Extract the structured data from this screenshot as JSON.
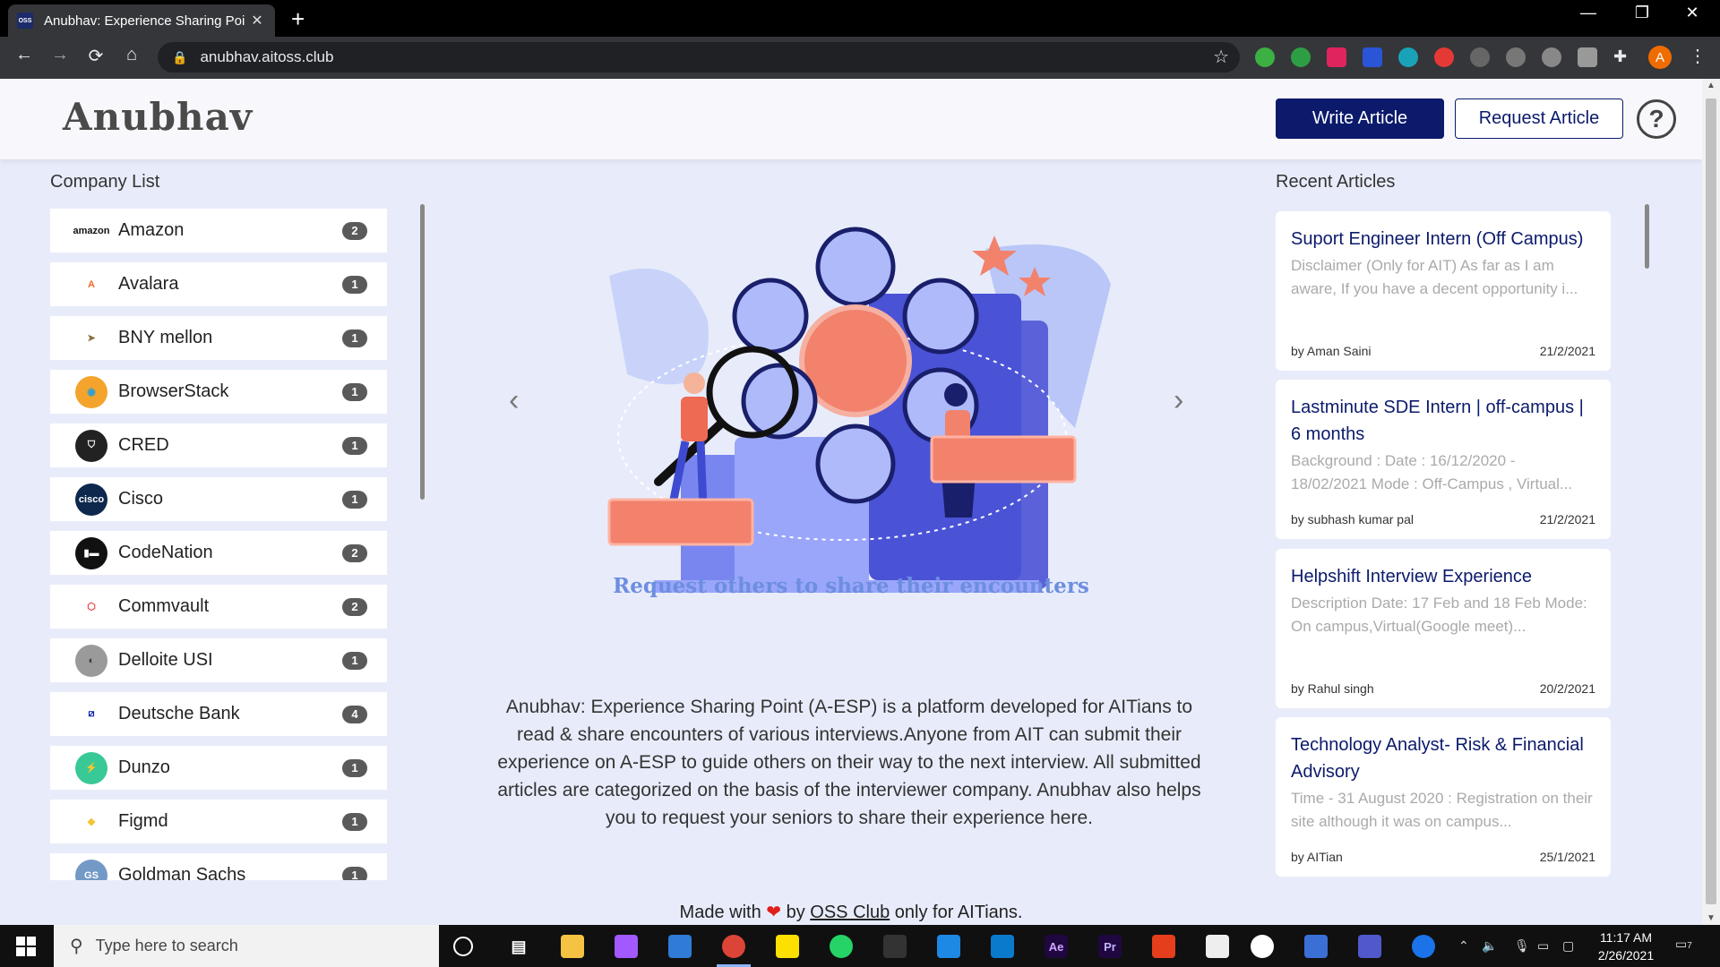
{
  "browser": {
    "tab_title": "Anubhav: Experience Sharing Poi",
    "tab_favicon_text": "OSS",
    "url": "anubhav.aitoss.club",
    "profile_initial": "A"
  },
  "header": {
    "logo": "Anubhav",
    "write_label": "Write Article",
    "request_label": "Request Article",
    "help_symbol": "?"
  },
  "company_section": {
    "title": "Company List",
    "items": [
      {
        "name": "Amazon",
        "count": "2",
        "logo_text": "amazon",
        "logo_color": "#111111",
        "logo_bg": "#ffffff"
      },
      {
        "name": "Avalara",
        "count": "1",
        "logo_text": "A",
        "logo_color": "#f2672a",
        "logo_bg": "#ffffff"
      },
      {
        "name": "BNY mellon",
        "count": "1",
        "logo_text": "➤",
        "logo_color": "#8a6d3b",
        "logo_bg": "#ffffff"
      },
      {
        "name": "BrowserStack",
        "count": "1",
        "logo_text": "◉",
        "logo_color": "#2a9fd6",
        "logo_bg": "#f4a42c"
      },
      {
        "name": "CRED",
        "count": "1",
        "logo_text": "⛉",
        "logo_color": "#ffffff",
        "logo_bg": "#222222"
      },
      {
        "name": "Cisco",
        "count": "1",
        "logo_text": "cisco",
        "logo_color": "#ffffff",
        "logo_bg": "#0d274d"
      },
      {
        "name": "CodeNation",
        "count": "2",
        "logo_text": "▮▬",
        "logo_color": "#ffffff",
        "logo_bg": "#111111"
      },
      {
        "name": "Commvault",
        "count": "2",
        "logo_text": "⬡",
        "logo_color": "#e0413d",
        "logo_bg": "#ffffff"
      },
      {
        "name": "Delloite USI",
        "count": "1",
        "logo_text": "◐",
        "logo_color": "#333333",
        "logo_bg": "#9a9a9a"
      },
      {
        "name": "Deutsche Bank",
        "count": "4",
        "logo_text": "⧄",
        "logo_color": "#0018a8",
        "logo_bg": "#ffffff"
      },
      {
        "name": "Dunzo",
        "count": "1",
        "logo_text": "⚡",
        "logo_color": "#111111",
        "logo_bg": "#38c996"
      },
      {
        "name": "Figmd",
        "count": "1",
        "logo_text": "◆",
        "logo_color": "#f4c430",
        "logo_bg": "#ffffff"
      },
      {
        "name": "Goldman Sachs",
        "count": "1",
        "logo_text": "GS",
        "logo_color": "#ffffff",
        "logo_bg": "#7399c6"
      }
    ]
  },
  "carousel": {
    "prev_symbol": "‹",
    "next_symbol": "›",
    "caption": "Request others to share their encounters"
  },
  "description": "Anubhav: Experience Sharing Point (A-ESP) is a platform developed for AITians to read & share encounters of various interviews.Anyone from AIT can submit their experience on A-ESP to guide others on their way to the next interview. All submitted articles are categorized on the basis of the interviewer company. Anubhav also helps you to request your seniors to share their experience here.",
  "footer": {
    "prefix": "Made with",
    "heart": "❤",
    "by": "by",
    "link": "OSS Club",
    "suffix": "only for AITians."
  },
  "articles_section": {
    "title": "Recent Articles",
    "items": [
      {
        "title": "Suport Engineer Intern (Off Campus)",
        "excerpt": "Disclaimer (Only for AIT) As far as I am aware, If you have a decent opportunity i...",
        "author": "by Aman Saini",
        "date": "21/2/2021"
      },
      {
        "title": "Lastminute SDE Intern | off-campus | 6 months",
        "excerpt": "Background : Date : 16/12/2020 - 18/02/2021 Mode : Off-Campus , Virtual...",
        "author": "by subhash kumar pal",
        "date": "21/2/2021"
      },
      {
        "title": "Helpshift Interview Experience",
        "excerpt": "Description Date: 17 Feb and 18 Feb Mode: On campus,Virtual(Google meet)...",
        "author": "by Rahul singh",
        "date": "20/2/2021"
      },
      {
        "title": "Technology Analyst- Risk & Financial Advisory",
        "excerpt": "Time - 31 August 2020 : Registration on their site although it was on campus...",
        "author": "by AITian",
        "date": "25/1/2021"
      }
    ]
  },
  "taskbar": {
    "search_placeholder": "Type here to search",
    "time": "11:17 AM",
    "date": "2/26/2021",
    "notification_count": "7"
  }
}
